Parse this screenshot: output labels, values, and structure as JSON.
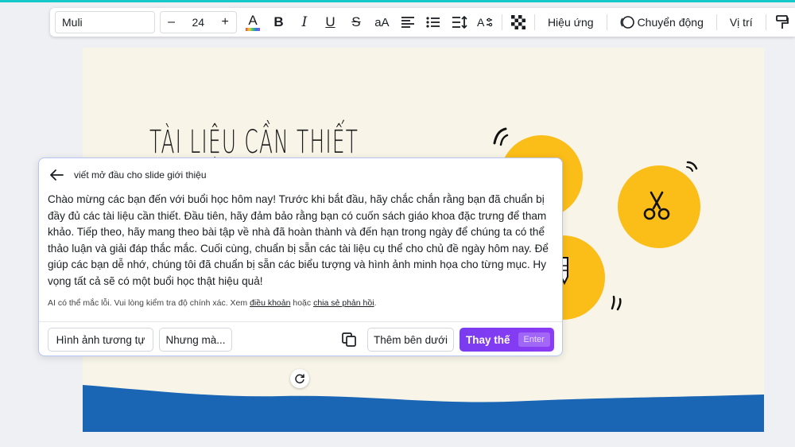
{
  "toolbar": {
    "font_family": "Muli",
    "font_size": "24",
    "decrease_label": "–",
    "increase_label": "+",
    "text_color_icon_label": "A",
    "bold_label": "B",
    "italic_label": "I",
    "underline_label": "U",
    "strike_label": "S",
    "case_label": "aA",
    "effects_label": "Hiệu ứng",
    "animate_label": "Chuyển động",
    "position_label": "Vị trí",
    "text_color_accent": "#e8452c"
  },
  "slide": {
    "title": "TÀI LIỆU CẦN THIẾT",
    "background": "#f8f5e8",
    "blob_color": "#fbbd17",
    "wave_color": "#1a66b5"
  },
  "ai_panel": {
    "prompt": "viết mở đầu cho slide giới thiệu",
    "generated_text": "Chào mừng các bạn đến với buổi học hôm nay! Trước khi bắt đầu, hãy chắc chắn rằng bạn đã chuẩn bị đầy đủ các tài liệu cần thiết. Đầu tiên, hãy đảm bảo rằng bạn có cuốn sách giáo khoa đặc trưng để tham khảo. Tiếp theo, hãy mang theo bài tập về nhà đã hoàn thành và đến hạn trong ngày để chúng ta có thể thảo luận và giải đáp thắc mắc. Cuối cùng, chuẩn bị sẵn các tài liệu cụ thể cho chủ đề ngày hôm nay. Để giúp các bạn dễ nhớ, chúng tôi đã chuẩn bị sẵn các biểu tượng và hình ảnh minh họa cho từng mục. Hy vọng tất cả sẽ có một buổi học thật hiệu quả!",
    "disclaimer_prefix": "AI có thể mắc lỗi. Vui lòng kiểm tra độ chính xác. Xem ",
    "terms_link": "điều khoản",
    "disclaimer_middle": " hoặc ",
    "feedback_link": "chia sẻ phản hồi",
    "disclaimer_suffix": ".",
    "btn_similar": "Hình ảnh tương tự",
    "btn_but": "Nhưng mà...",
    "btn_insert_below": "Thêm bên dưới",
    "btn_replace": "Thay thế",
    "replace_shortcut": "Enter",
    "accent_color": "#7d3cf0"
  },
  "icons": {
    "back": "back-arrow-icon",
    "copy": "copy-icon",
    "rotate": "rotate-icon",
    "scissors": "scissors-icon",
    "paint": "paint-roller-icon"
  }
}
